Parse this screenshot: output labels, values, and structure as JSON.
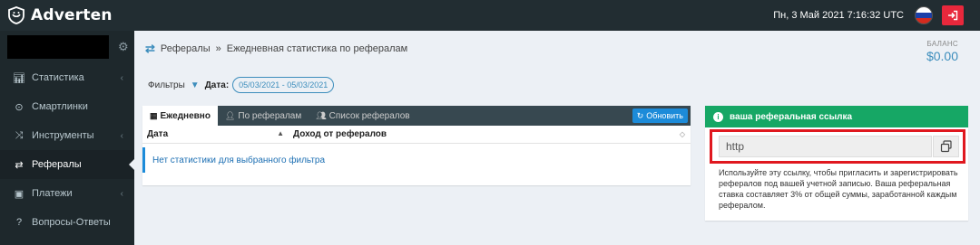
{
  "brand": {
    "name": "Adverten"
  },
  "topbar": {
    "datetime": "Пн, 3 Май 2021 7:16:32 UTC"
  },
  "colors": {
    "sidebar": "#1e282c",
    "topbar": "#222d32",
    "accent": "#3c8dbc",
    "success": "#16a765",
    "danger": "#e8283c",
    "highlight": "#e0181f"
  },
  "sidebar": {
    "items": [
      {
        "label": "Статистика",
        "icon": "bar-chart-icon",
        "active": false,
        "has_submenu": true
      },
      {
        "label": "Смартлинки",
        "icon": "compass-icon",
        "active": false,
        "has_submenu": false
      },
      {
        "label": "Инструменты",
        "icon": "shuffle-icon",
        "active": false,
        "has_submenu": true
      },
      {
        "label": "Рефералы",
        "icon": "exchange-icon",
        "active": true,
        "has_submenu": false
      },
      {
        "label": "Платежи",
        "icon": "money-icon",
        "active": false,
        "has_submenu": true
      },
      {
        "label": "Вопросы-Ответы",
        "icon": "question-icon",
        "active": false,
        "has_submenu": false
      }
    ]
  },
  "breadcrumb": {
    "section": "Рефералы",
    "separator": "»",
    "page": "Ежедневная статистика по рефералам"
  },
  "balance": {
    "label": "БАЛАНС",
    "value": "$0.00"
  },
  "filters": {
    "label": "Фильтры",
    "date_label": "Дата:",
    "date_range": "05/03/2021 - 05/03/2021"
  },
  "stats": {
    "tabs": [
      {
        "label": "Ежедневно",
        "icon": "calendar-icon",
        "active": true
      },
      {
        "label": "По рефералам",
        "icon": "person-icon",
        "active": false
      },
      {
        "label": "Список рефералов",
        "icon": "users-icon",
        "active": false
      }
    ],
    "refresh_label": "Обновить",
    "columns": [
      "Дата",
      "Доход от рефералов"
    ],
    "empty_message": "Нет статистики для выбранного фильтра"
  },
  "referral": {
    "header": "ваша реферальная ссылка",
    "link_value": "http",
    "note": "Используйте эту ссылку, чтобы пригласить и зарегистрировать рефералов под вашей учетной записью. Ваша реферальная ставка составляет 3% от общей суммы, заработанной каждым рефералом."
  }
}
